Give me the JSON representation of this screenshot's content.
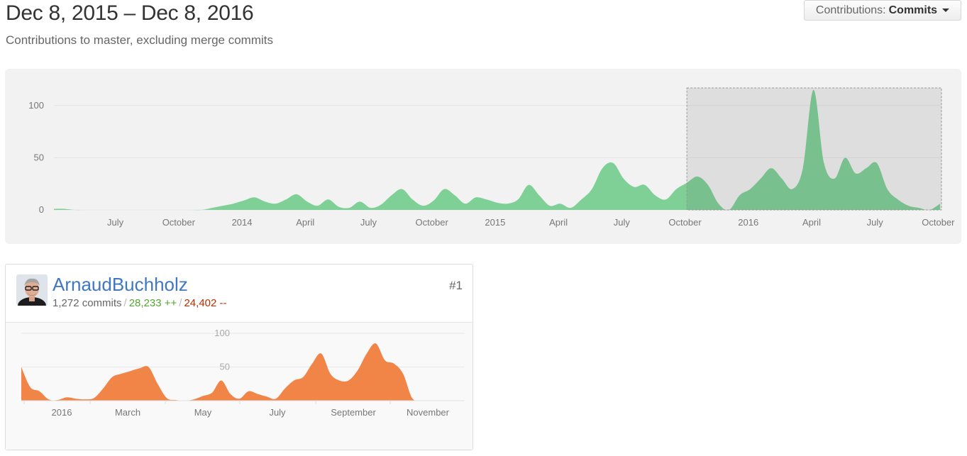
{
  "header": {
    "title": "Dec 8, 2015 – Dec 8, 2016",
    "subtitle": "Contributions to master, excluding merge commits"
  },
  "contributions_menu": {
    "label_prefix": "Contributions:",
    "selected": "Commits",
    "icon": "caret-down-icon"
  },
  "colors": {
    "overview_fill": "#7ed096",
    "overview_fill_selected": "#6cbd86",
    "selection_shade": "#dcdcdc",
    "user_fill": "#f18447",
    "link": "#4078c0",
    "additions": "#55a532",
    "deletions": "#bd2c00"
  },
  "contributor": {
    "username": "ArnaudBuchholz",
    "rank": "#1",
    "commits": "1,272 commits",
    "additions": "28,233 ++",
    "deletions": "24,402 --",
    "avatar_icon": "user-avatar"
  },
  "chart_data": [
    {
      "type": "area",
      "name": "overview",
      "x_tick_labels": [
        "July",
        "October",
        "2014",
        "April",
        "July",
        "October",
        "2015",
        "April",
        "July",
        "October",
        "2016",
        "April",
        "July",
        "October"
      ],
      "y_tick_labels": [
        "0",
        "50",
        "100"
      ],
      "ylim": [
        0,
        125
      ],
      "grid": true,
      "x": [
        0,
        0.5,
        1,
        1.5,
        2,
        2.5,
        3,
        3.5,
        4,
        4.5,
        5,
        5.5,
        6,
        6.5,
        7,
        7.5,
        8,
        8.5,
        9,
        9.5,
        10,
        10.5,
        11,
        11.5,
        12,
        12.5,
        13,
        13.5,
        14,
        14.5,
        15,
        15.5,
        16,
        16.5,
        17,
        17.5,
        18,
        18.5,
        19,
        19.5,
        20,
        20.5,
        21,
        21.5,
        22,
        22.5,
        23,
        23.5,
        24,
        24.5,
        25,
        25.5,
        26,
        26.5,
        27,
        27.5,
        28,
        28.5,
        29,
        29.5,
        30,
        30.5,
        31,
        31.5,
        32,
        32.5,
        33,
        33.5,
        34,
        34.5,
        35,
        35.5,
        36,
        36.5,
        37,
        37.5,
        38,
        38.5,
        39,
        39.5,
        40,
        40.5,
        41,
        41.5,
        42
      ],
      "values": [
        1,
        1,
        0,
        0,
        0,
        0,
        0,
        0,
        0,
        0,
        0,
        0,
        0,
        0,
        0,
        2,
        4,
        6,
        9,
        12,
        8,
        6,
        10,
        15,
        8,
        4,
        10,
        3,
        2,
        8,
        2,
        5,
        14,
        20,
        10,
        4,
        9,
        20,
        14,
        6,
        12,
        10,
        7,
        6,
        10,
        24,
        14,
        4,
        6,
        2,
        10,
        20,
        40,
        45,
        30,
        22,
        24,
        14,
        10,
        20,
        26,
        32,
        24,
        6,
        0,
        14,
        20,
        30,
        40,
        30,
        20,
        40,
        115,
        45,
        30,
        50,
        35,
        40,
        45,
        20,
        10,
        4,
        2,
        0,
        6
      ],
      "selection": {
        "from_month": "2015-12",
        "to_month": "2016-12"
      }
    },
    {
      "type": "area",
      "name": "ArnaudBuchholz",
      "x_tick_labels": [
        "2016",
        "March",
        "May",
        "July",
        "September",
        "November"
      ],
      "y_tick_labels": [
        "50",
        "100"
      ],
      "ylim": [
        0,
        100
      ],
      "x": [
        0,
        0.25,
        0.5,
        0.75,
        1,
        1.25,
        1.5,
        1.75,
        2,
        2.25,
        2.5,
        2.75,
        3,
        3.25,
        3.5,
        3.75,
        4,
        4.25,
        4.5,
        4.75,
        5,
        5.25,
        5.5,
        5.75,
        6,
        6.25,
        6.5,
        6.75,
        7,
        7.25,
        7.5,
        7.75,
        8,
        8.25,
        8.5,
        8.75,
        9,
        9.25,
        9.5,
        9.75,
        10,
        10.25,
        10.5,
        10.75,
        11,
        11.25,
        11.5,
        11.75,
        12
      ],
      "values": [
        50,
        20,
        14,
        2,
        1,
        5,
        3,
        2,
        4,
        18,
        35,
        40,
        44,
        48,
        50,
        25,
        4,
        1,
        0,
        2,
        7,
        12,
        30,
        10,
        3,
        14,
        10,
        6,
        3,
        18,
        30,
        35,
        55,
        70,
        40,
        30,
        30,
        45,
        70,
        85,
        60,
        55,
        40,
        4,
        0,
        0,
        0,
        0,
        0
      ]
    }
  ]
}
